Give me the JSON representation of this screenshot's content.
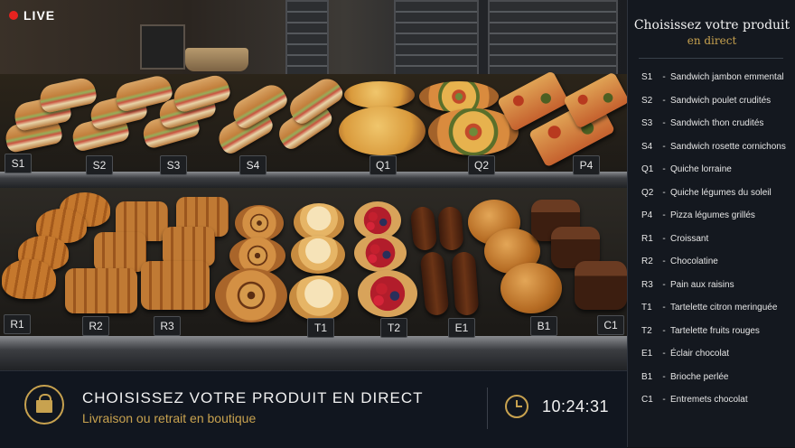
{
  "live": {
    "label": "LIVE",
    "color": "#e8231f"
  },
  "shelf_tags": {
    "top": [
      "S1",
      "S2",
      "S3",
      "S4",
      "Q1",
      "Q2",
      "P4"
    ],
    "bottom": [
      "R1",
      "R2",
      "R3",
      "T1",
      "T2",
      "E1",
      "B1",
      "C1"
    ]
  },
  "banner": {
    "title": "CHOISISSEZ VOTRE PRODUIT EN DIRECT",
    "subtitle": "Livraison ou retrait en boutique",
    "time": "10:24:31",
    "bag_icon": "shopping-bag-icon",
    "clock_icon": "clock-icon"
  },
  "panel": {
    "title": "Choisissez votre produit",
    "subtitle": "en direct",
    "items": [
      {
        "code": "S1",
        "sep": "-",
        "name": "Sandwich jambon emmental"
      },
      {
        "code": "S2",
        "sep": "-",
        "name": "Sandwich poulet crudités"
      },
      {
        "code": "S3",
        "sep": "-",
        "name": "Sandwich thon crudités"
      },
      {
        "code": "S4",
        "sep": "-",
        "name": "Sandwich rosette cornichons"
      },
      {
        "code": "Q1",
        "sep": "-",
        "name": "Quiche lorraine"
      },
      {
        "code": "Q2",
        "sep": "-",
        "name": "Quiche légumes du soleil"
      },
      {
        "code": "P4",
        "sep": "-",
        "name": "Pizza légumes grillés"
      },
      {
        "code": "R1",
        "sep": "-",
        "name": "Croissant"
      },
      {
        "code": "R2",
        "sep": "-",
        "name": "Chocolatine"
      },
      {
        "code": "R3",
        "sep": "-",
        "name": "Pain aux raisins"
      },
      {
        "code": "T1",
        "sep": "-",
        "name": "Tartelette citron meringuée"
      },
      {
        "code": "T2",
        "sep": "-",
        "name": "Tartelette fruits rouges"
      },
      {
        "code": "E1",
        "sep": "-",
        "name": "Éclair chocolat"
      },
      {
        "code": "B1",
        "sep": "-",
        "name": "Brioche perlée"
      },
      {
        "code": "C1",
        "sep": "-",
        "name": "Entremets chocolat"
      }
    ]
  },
  "colors": {
    "accent": "#c8a24f",
    "panel_bg": "#14181f",
    "banner_bg": "#11161f"
  }
}
